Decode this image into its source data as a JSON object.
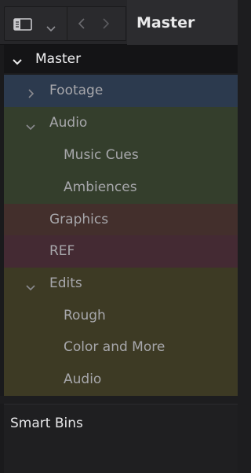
{
  "toolbar": {
    "title": "Master",
    "icons": {
      "sidebar_toggle": "sidebar-panel-icon",
      "view_dropdown": "chevron-down-icon",
      "back": "chevron-left-icon",
      "forward": "chevron-right-icon"
    }
  },
  "tree": {
    "root": {
      "label": "Master",
      "expanded": true
    },
    "items": [
      {
        "label": "Footage",
        "level": 1,
        "expandable": true,
        "expanded": false,
        "color": "#2c3a4e"
      },
      {
        "label": "Audio",
        "level": 1,
        "expandable": true,
        "expanded": true,
        "color": "#343e2c"
      },
      {
        "label": "Music Cues",
        "level": 2,
        "expandable": false,
        "color": "#343e2c"
      },
      {
        "label": "Ambiences",
        "level": 2,
        "expandable": false,
        "color": "#343e2c"
      },
      {
        "label": "Graphics",
        "level": 1,
        "expandable": false,
        "color": "#432f2c"
      },
      {
        "label": "REF",
        "level": 1,
        "expandable": false,
        "color": "#442a33"
      },
      {
        "label": "Edits",
        "level": 1,
        "expandable": true,
        "expanded": true,
        "color": "#3d3a24"
      },
      {
        "label": "Rough",
        "level": 2,
        "expandable": false,
        "color": "#3d3a24"
      },
      {
        "label": "Color and More",
        "level": 2,
        "expandable": false,
        "color": "#3d3a24"
      },
      {
        "label": "Audio",
        "level": 2,
        "expandable": false,
        "color": "#3d3a24"
      }
    ]
  },
  "smart_bins": {
    "label": "Smart Bins"
  }
}
